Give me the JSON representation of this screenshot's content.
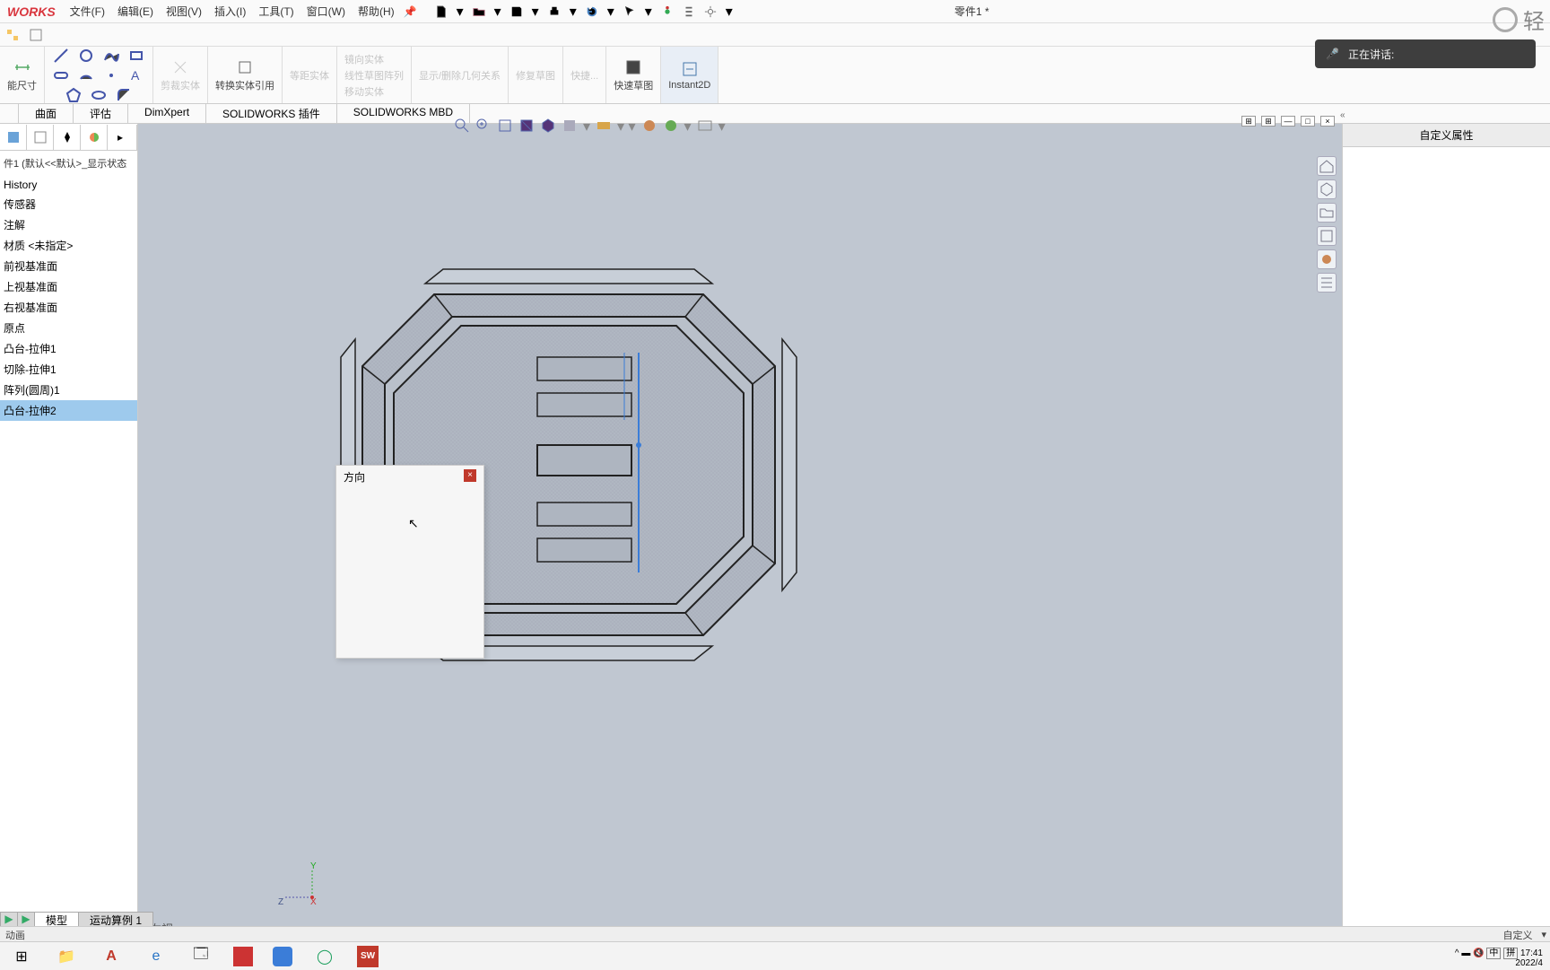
{
  "logo": "WORKS",
  "menus": {
    "file": "文件(F)",
    "edit": "编辑(E)",
    "view": "视图(V)",
    "insert": "插入(I)",
    "tools": "工具(T)",
    "window": "窗口(W)",
    "help": "帮助(H)"
  },
  "doc_title": "零件1 *",
  "qing_text": "轻",
  "ribbon": {
    "smart_dim": "能尺寸",
    "trim": "剪裁实体",
    "convert": "转换实体引用",
    "offset": "等距实体",
    "mirror": "镜向实体",
    "linear": "线性草图阵列",
    "move": "移动实体",
    "display": "显示/删除几何关系",
    "repair": "修复草图",
    "quick": "快捷...",
    "rapid": "快速草图",
    "instant": "Instant2D"
  },
  "tabs": {
    "t1": "曲面",
    "t2": "评估",
    "t3": "DimXpert",
    "t4": "SOLIDWORKS 插件",
    "t5": "SOLIDWORKS MBD"
  },
  "tree": {
    "header": "件1 (默认<<默认>_显示状态",
    "items": [
      "History",
      "传感器",
      "注解",
      "材质 <未指定>",
      "前视基准面",
      "上视基准面",
      "右视基准面",
      "原点",
      "凸台-拉伸1",
      "切除-拉伸1",
      "阵列(圆周)1",
      "凸台-拉伸2"
    ]
  },
  "right_panel_title": "自定义属性",
  "dir_popup": "方向",
  "triad": {
    "x": "X",
    "y": "Y",
    "z": "Z"
  },
  "view_name": "*右视",
  "bottom_tabs": {
    "model": "模型",
    "motion": "运动算例 1"
  },
  "status_left": "动画",
  "status_right": "自定义",
  "speaking": "正在讲话:",
  "ime": {
    "zhong": "中",
    "pin": "拼"
  },
  "time": "17:41",
  "date": "2022/4"
}
